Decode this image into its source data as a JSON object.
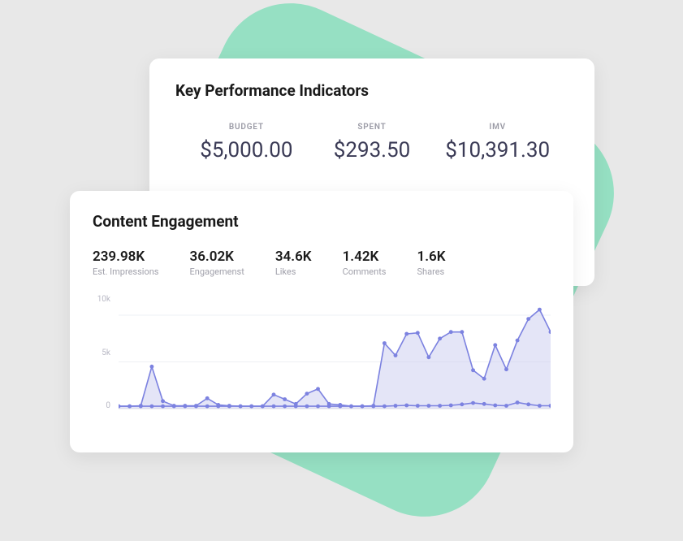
{
  "kpi": {
    "title": "Key Performance Indicators",
    "items": [
      {
        "label": "BUDGET",
        "value": "$5,000.00"
      },
      {
        "label": "SPENT",
        "value": "$293.50"
      },
      {
        "label": "IMV",
        "value": "$10,391.30"
      }
    ]
  },
  "content": {
    "title": "Content Engagement",
    "metrics": [
      {
        "value": "239.98K",
        "label": "Est. Impressions"
      },
      {
        "value": "36.02K",
        "label": "Engagemenst"
      },
      {
        "value": "34.6K",
        "label": "Likes"
      },
      {
        "value": "1.42K",
        "label": "Comments"
      },
      {
        "value": "1.6K",
        "label": "Shares"
      }
    ]
  },
  "chart_data": {
    "type": "line",
    "ylabel": "",
    "xlabel": "",
    "ylim": [
      0,
      12000
    ],
    "yticks": [
      0,
      5000,
      10000
    ],
    "ytick_labels": [
      "0",
      "5k",
      "10k"
    ],
    "x": [
      1,
      2,
      3,
      4,
      5,
      6,
      7,
      8,
      9,
      10,
      11,
      12,
      13,
      14,
      15,
      16,
      17,
      18,
      19,
      20,
      21,
      22,
      23,
      24,
      25,
      26,
      27,
      28,
      29,
      30,
      31,
      32,
      33,
      34,
      35,
      36,
      37,
      38,
      39,
      40
    ],
    "series": [
      {
        "name": "series-a",
        "values": [
          250,
          250,
          300,
          4500,
          800,
          300,
          300,
          300,
          1100,
          400,
          300,
          250,
          250,
          250,
          1500,
          1000,
          500,
          1600,
          2100,
          500,
          400,
          250,
          250,
          300,
          7000,
          5700,
          8000,
          8100,
          5500,
          7500,
          8200,
          8200,
          4100,
          3200,
          6800,
          4200,
          7300,
          9600,
          10600,
          8200
        ]
      },
      {
        "name": "series-b",
        "values": [
          250,
          250,
          250,
          250,
          250,
          250,
          250,
          250,
          250,
          250,
          250,
          250,
          250,
          250,
          250,
          250,
          250,
          250,
          250,
          250,
          250,
          250,
          250,
          250,
          250,
          300,
          350,
          300,
          300,
          300,
          350,
          450,
          600,
          500,
          350,
          300,
          650,
          450,
          300,
          300
        ]
      }
    ]
  },
  "colors": {
    "accent": "#7c82e0",
    "area": "#cdd0f0",
    "bg_shape": "#96e0c3"
  }
}
